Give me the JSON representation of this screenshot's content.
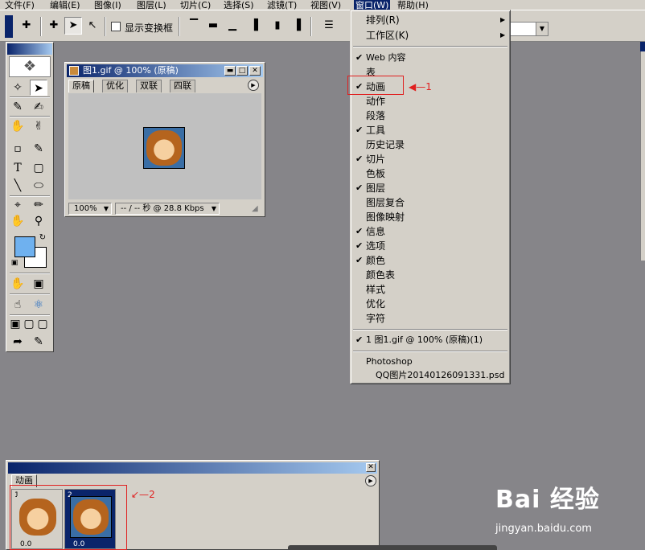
{
  "menubar": {
    "items": [
      "文件(F)",
      "编辑(E)",
      "图像(I)",
      "图层(L)",
      "切片(C)",
      "选择(S)",
      "滤镜(T)",
      "视图(V)",
      "窗口(W)",
      "帮助(H)"
    ]
  },
  "options_bar": {
    "transform_label": "显示变换框"
  },
  "doc_window": {
    "title": "图1.gif @ 100% (原稿)",
    "tabs": [
      "原稿",
      "优化",
      "双联",
      "四联"
    ],
    "zoom": "100%",
    "status": "-- / -- 秒 @ 28.8 Kbps"
  },
  "window_menu": {
    "arrange": "排列(R)",
    "workspace": "工作区(K)",
    "items": [
      {
        "label": "Web 内容",
        "checked": true
      },
      {
        "label": "表",
        "checked": false
      },
      {
        "label": "动画",
        "checked": true
      },
      {
        "label": "动作",
        "checked": false
      },
      {
        "label": "段落",
        "checked": false
      },
      {
        "label": "工具",
        "checked": true
      },
      {
        "label": "历史记录",
        "checked": false
      },
      {
        "label": "切片",
        "checked": true
      },
      {
        "label": "色板",
        "checked": false
      },
      {
        "label": "图层",
        "checked": true
      },
      {
        "label": "图层复合",
        "checked": false
      },
      {
        "label": "图像映射",
        "checked": false
      },
      {
        "label": "信息",
        "checked": true
      },
      {
        "label": "选项",
        "checked": true
      },
      {
        "label": "颜色",
        "checked": true
      },
      {
        "label": "颜色表",
        "checked": false
      },
      {
        "label": "样式",
        "checked": false
      },
      {
        "label": "优化",
        "checked": false
      },
      {
        "label": "字符",
        "checked": false
      }
    ],
    "open_doc": "1 图1.gif @ 100% (原稿)(1)",
    "photoshop": "Photoshop",
    "psd_file": "QQ图片20140126091331.psd"
  },
  "annotations": {
    "label1": "1",
    "label2": "2"
  },
  "animation_panel": {
    "tab": "动画",
    "frames": [
      {
        "num": "1",
        "delay": "0.0"
      },
      {
        "num": "2",
        "delay": "0.0"
      }
    ]
  },
  "watermark": {
    "brand": "Bai 经验",
    "url": "jingyan.baidu.com"
  },
  "colors": {
    "foreground": "#6fb1ef",
    "background": "#ffffff",
    "titlebar": "#0a246a",
    "annotation": "#e02020"
  }
}
